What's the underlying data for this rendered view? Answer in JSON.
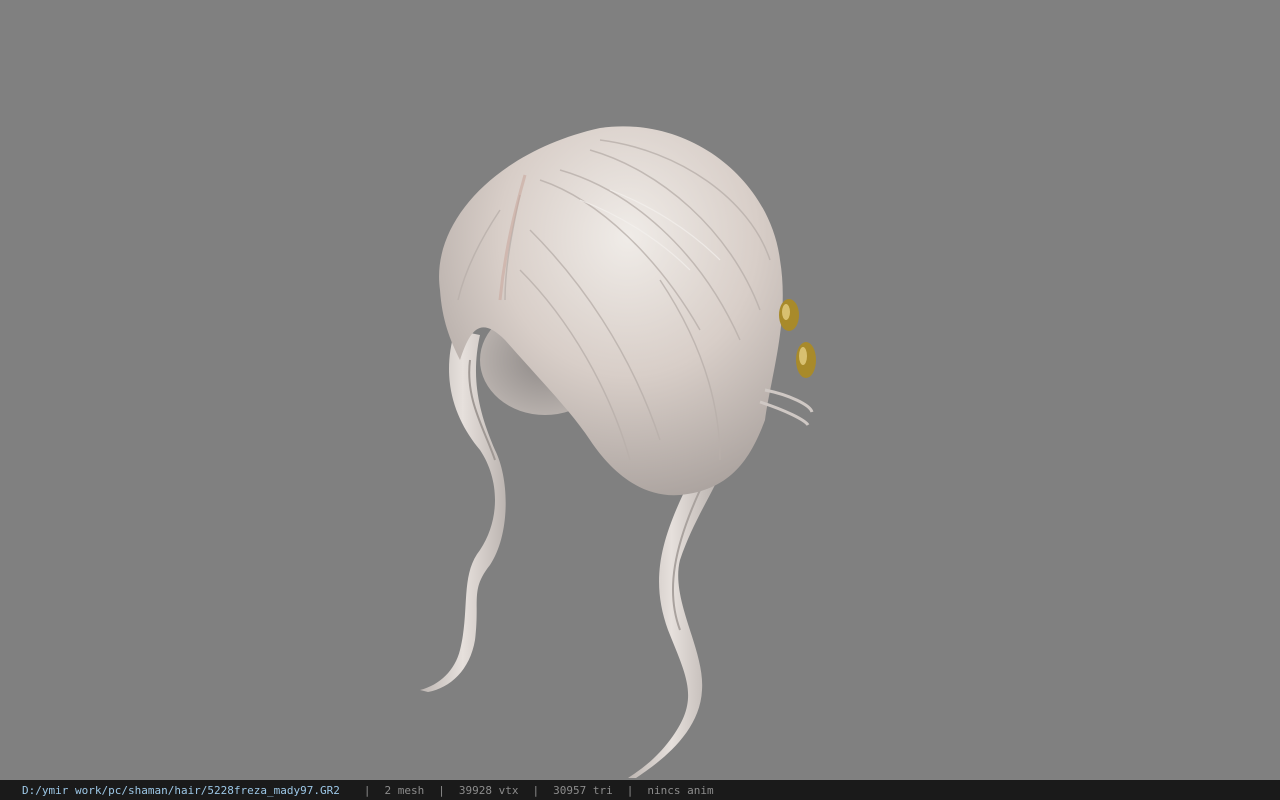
{
  "viewer": {
    "model_icon": "hair-model",
    "background_color": "#808080",
    "hair_color": "#d9d0cb",
    "accent_color": "#a88a2a"
  },
  "status_bar": {
    "file_path": "D:/ymir work/pc/shaman/hair/5228freza_mady97.GR2",
    "separator": "|",
    "mesh_count": "2 mesh",
    "vertex_count": "39928 vtx",
    "triangle_count": "30957 tri",
    "anim_status": "nincs anim"
  }
}
